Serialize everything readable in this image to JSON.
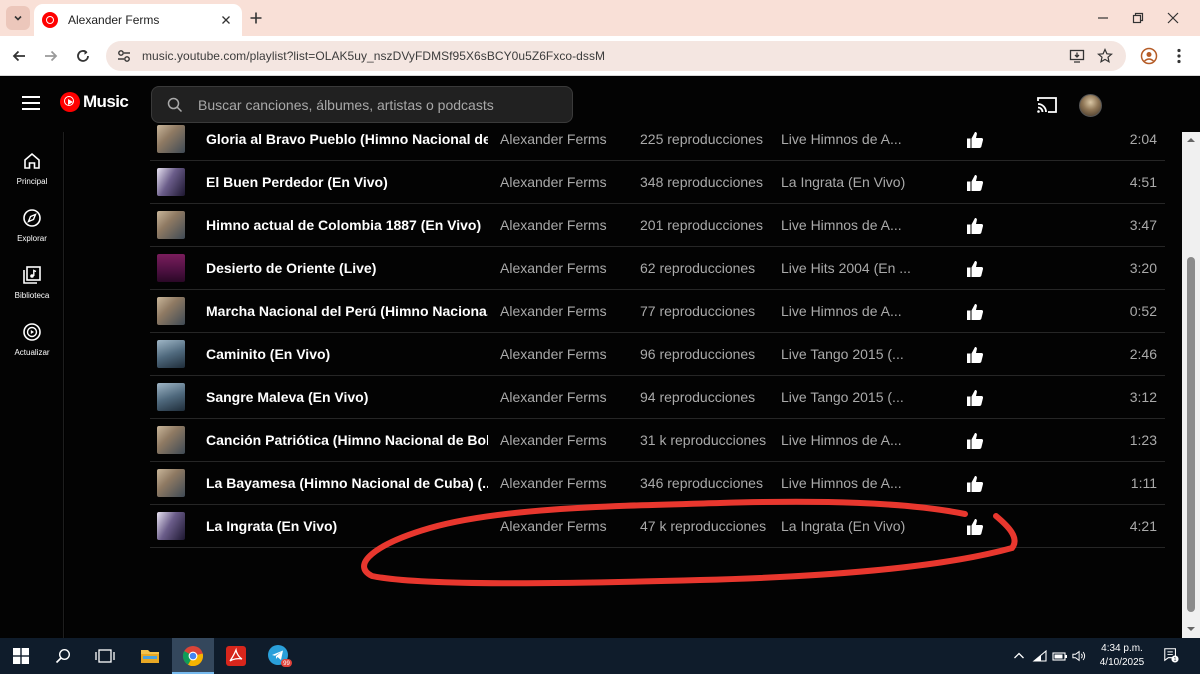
{
  "browser": {
    "tab_title": "Alexander Ferms",
    "url": "music.youtube.com/playlist?list=OLAK5uy_nszDVyFDMSf95X6sBCY0u5Z6Fxco-dssM"
  },
  "app": {
    "logo_text": "Music",
    "search_placeholder": "Buscar canciones, álbumes, artistas o podcasts"
  },
  "sidebar": {
    "items": [
      {
        "label": "Principal",
        "icon": "home-icon"
      },
      {
        "label": "Explorar",
        "icon": "compass-icon"
      },
      {
        "label": "Biblioteca",
        "icon": "library-icon"
      },
      {
        "label": "Actualizar",
        "icon": "upgrade-icon"
      }
    ]
  },
  "tracks": [
    {
      "title": "Gloria al Bravo Pueblo (Himno Nacional de...",
      "artist": "Alexander Ferms",
      "plays": "225 reproducciones",
      "album": "Live Himnos de A...",
      "duration": "2:04",
      "thumb": "portrait"
    },
    {
      "title": "El Buen Perdedor (En Vivo)",
      "artist": "Alexander Ferms",
      "plays": "348 reproducciones",
      "album": "La Ingrata (En Vivo)",
      "duration": "4:51",
      "thumb": "ingrata"
    },
    {
      "title": "Himno actual de Colombia 1887 (En Vivo)",
      "artist": "Alexander Ferms",
      "plays": "201 reproducciones",
      "album": "Live Himnos de A...",
      "duration": "3:47",
      "thumb": "portrait"
    },
    {
      "title": "Desierto de Oriente (Live)",
      "artist": "Alexander Ferms",
      "plays": "62 reproducciones",
      "album": "Live Hits 2004 (En ...",
      "duration": "3:20",
      "thumb": "hits"
    },
    {
      "title": "Marcha Nacional del Perú (Himno Naciona...",
      "artist": "Alexander Ferms",
      "plays": "77 reproducciones",
      "album": "Live Himnos de A...",
      "duration": "0:52",
      "thumb": "portrait"
    },
    {
      "title": "Caminito (En Vivo)",
      "artist": "Alexander Ferms",
      "plays": "96 reproducciones",
      "album": "Live Tango 2015 (...",
      "duration": "2:46",
      "thumb": "tango"
    },
    {
      "title": "Sangre Maleva (En Vivo)",
      "artist": "Alexander Ferms",
      "plays": "94 reproducciones",
      "album": "Live Tango 2015 (...",
      "duration": "3:12",
      "thumb": "tango"
    },
    {
      "title": "Canción Patriótica (Himno Nacional de Boli...",
      "artist": "Alexander Ferms",
      "plays": "31 k reproducciones",
      "album": "Live Himnos de A...",
      "duration": "1:23",
      "thumb": "portrait"
    },
    {
      "title": "La Bayamesa (Himno Nacional de Cuba) (...",
      "artist": "Alexander Ferms",
      "plays": "346 reproducciones",
      "album": "Live Himnos de A...",
      "duration": "1:11",
      "thumb": "portrait"
    },
    {
      "title": "La Ingrata (En Vivo)",
      "artist": "Alexander Ferms",
      "plays": "47 k reproducciones",
      "album": "La Ingrata (En Vivo)",
      "duration": "4:21",
      "thumb": "ingrata"
    }
  ],
  "taskbar": {
    "time": "4:34 p.m.",
    "date": "4/10/2025",
    "notification_count": "1",
    "telegram_badge": "99"
  },
  "colors": {
    "annotation": "#e8372e",
    "yt_red": "#ff0000",
    "tab_strip": "#f9e0d7"
  }
}
